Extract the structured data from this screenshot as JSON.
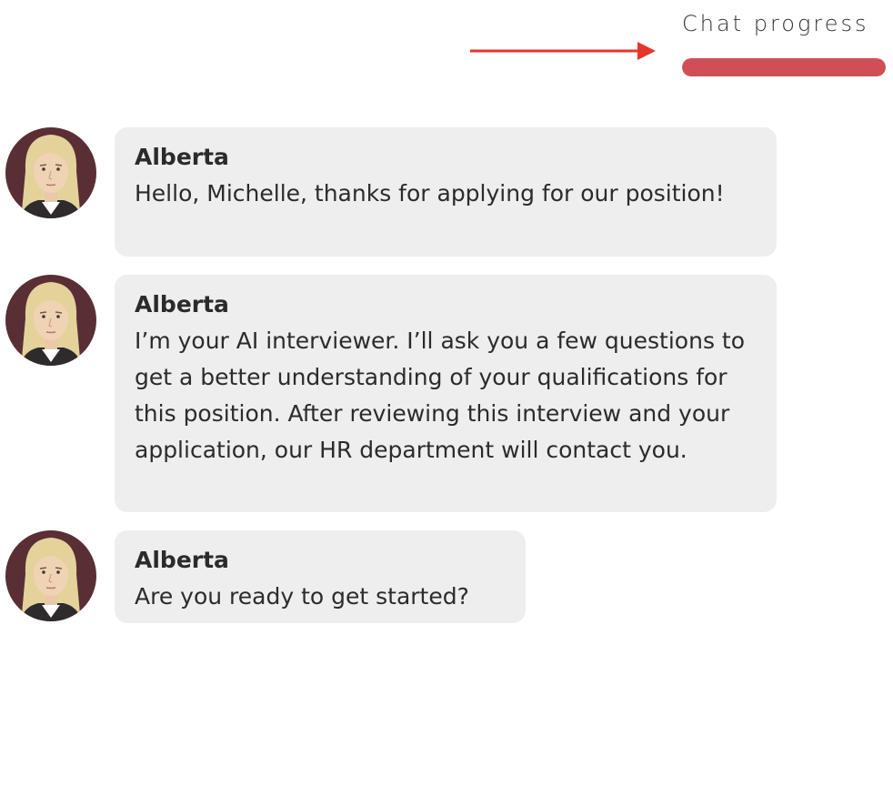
{
  "progress": {
    "label": "Chat progress",
    "fraction": 1.0,
    "fill_color": "#d04f57",
    "arrow_color": "#e8352b"
  },
  "messages": [
    {
      "sender": "Alberta",
      "text": "Hello, Michelle, thanks for applying for our position!",
      "avatar": "avatar-alberta"
    },
    {
      "sender": "Alberta",
      "text": "I’m your AI interviewer. I’ll ask you a few questions to get a better understanding of your qualifications for this position. After reviewing this interview and your application, our HR department will contact you.",
      "avatar": "avatar-alberta"
    },
    {
      "sender": "Alberta",
      "text": "Are you ready to get started?",
      "avatar": "avatar-alberta"
    }
  ]
}
